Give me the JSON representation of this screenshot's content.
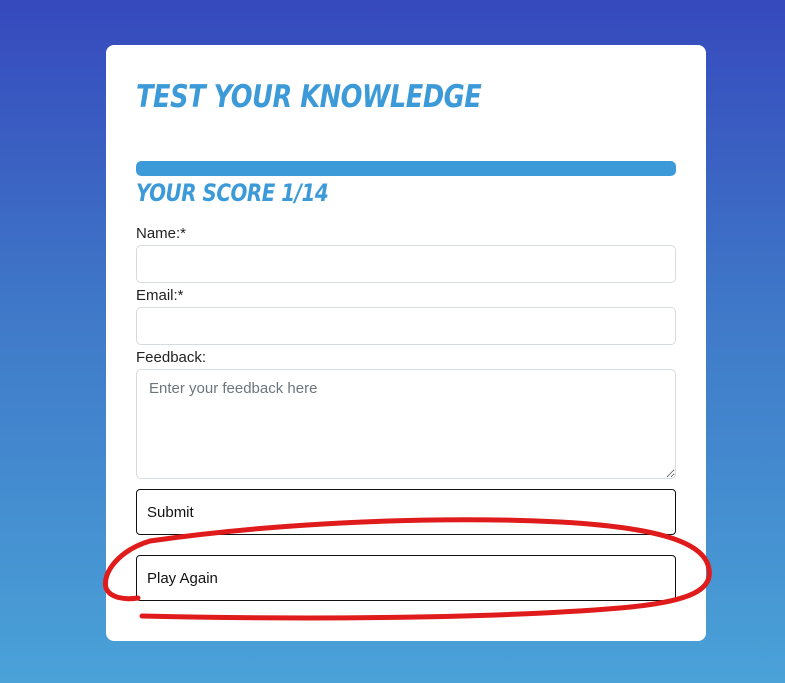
{
  "quiz": {
    "title": "Test Your Knowledge",
    "score_text": "Your Score 1/14",
    "progress_fraction": 1.0
  },
  "form": {
    "name_label": "Name:*",
    "email_label": "Email:*",
    "feedback_label": "Feedback:",
    "feedback_placeholder": "Enter your feedback here",
    "name_value": "",
    "email_value": "",
    "submit_label": "Submit",
    "play_again_label": "Play Again"
  },
  "colors": {
    "accent": "#3d9ad9",
    "annotation": "#e01b1b"
  }
}
